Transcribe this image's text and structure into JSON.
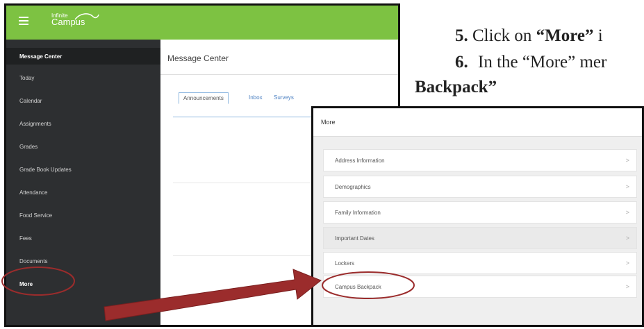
{
  "instructions": {
    "step5_num": "5.",
    "step5_prefix": "Click on ",
    "step5_bold": "“More”",
    "step5_suffix": " i",
    "step6_num": "6.",
    "step6_text": "In the “More” mer",
    "step6_cont": "Backpack”"
  },
  "app": {
    "logo_line1": "Infinite",
    "logo_line2": "Campus",
    "brand_color": "#7dc242"
  },
  "sidebar": {
    "items": [
      {
        "label": "Message Center"
      },
      {
        "label": "Today"
      },
      {
        "label": "Calendar"
      },
      {
        "label": "Assignments"
      },
      {
        "label": "Grades"
      },
      {
        "label": "Grade Book Updates"
      },
      {
        "label": "Attendance"
      },
      {
        "label": "Food Service"
      },
      {
        "label": "Fees"
      },
      {
        "label": "Documents"
      },
      {
        "label": "More"
      }
    ]
  },
  "main": {
    "title": "Message Center",
    "tabs": [
      {
        "label": "Announcements"
      },
      {
        "label": "Inbox"
      },
      {
        "label": "Surveys"
      }
    ]
  },
  "more_menu": {
    "title": "More",
    "items": [
      {
        "label": "Address Information"
      },
      {
        "label": "Demographics"
      },
      {
        "label": "Family Information"
      },
      {
        "label": "Important Dates"
      },
      {
        "label": "Lockers"
      },
      {
        "label": "Campus Backpack"
      }
    ],
    "chevron": ">"
  },
  "annotation_color": "#9b2c2c"
}
